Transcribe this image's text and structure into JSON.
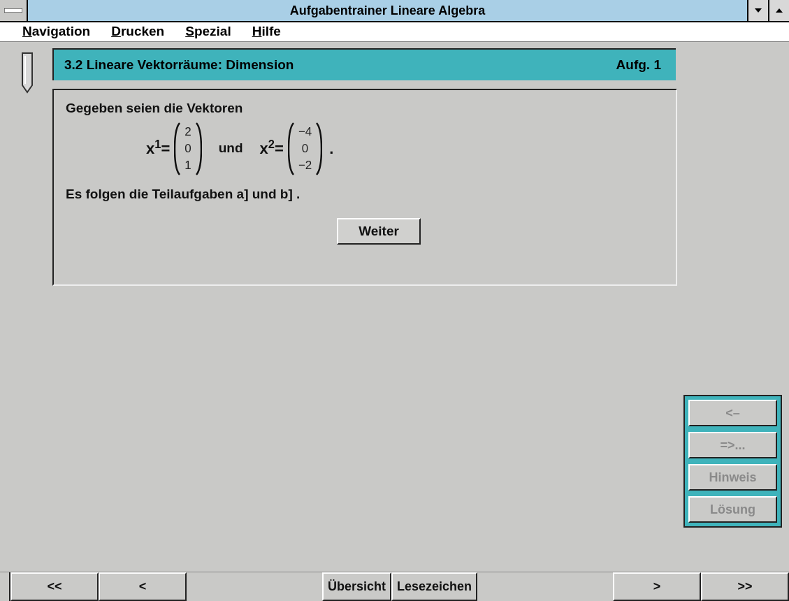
{
  "window": {
    "title": "Aufgabentrainer  Lineare Algebra"
  },
  "menu": [
    {
      "label": "Navigation"
    },
    {
      "label": "Drucken"
    },
    {
      "label": "Spezial"
    },
    {
      "label": "Hilfe"
    }
  ],
  "section": {
    "title": "3.2 Lineare Vektorräume: Dimension",
    "task": "Aufg. 1"
  },
  "exercise": {
    "intro": "Gegeben seien die Vektoren",
    "vectors": [
      {
        "label": "x$^{1}$=",
        "components": [
          "2",
          "0",
          "1"
        ]
      },
      {
        "label": "x$^{2}$=",
        "components": [
          "−4",
          "0",
          "−2"
        ]
      }
    ],
    "connector": "und",
    "end": ".",
    "followup": "Es folgen die Teilaufgaben a] und b] .",
    "button": "Weiter"
  },
  "side_buttons": [
    {
      "label": "<–",
      "disabled": true
    },
    {
      "label": "=>...",
      "disabled": true
    },
    {
      "label": "Hinweis",
      "disabled": true
    },
    {
      "label": "Lösung",
      "disabled": true
    }
  ],
  "nav_left": [
    "<<",
    "<"
  ],
  "nav_center": [
    "Übersicht",
    "Lesezeichen"
  ],
  "nav_right": [
    ">",
    ">>"
  ]
}
